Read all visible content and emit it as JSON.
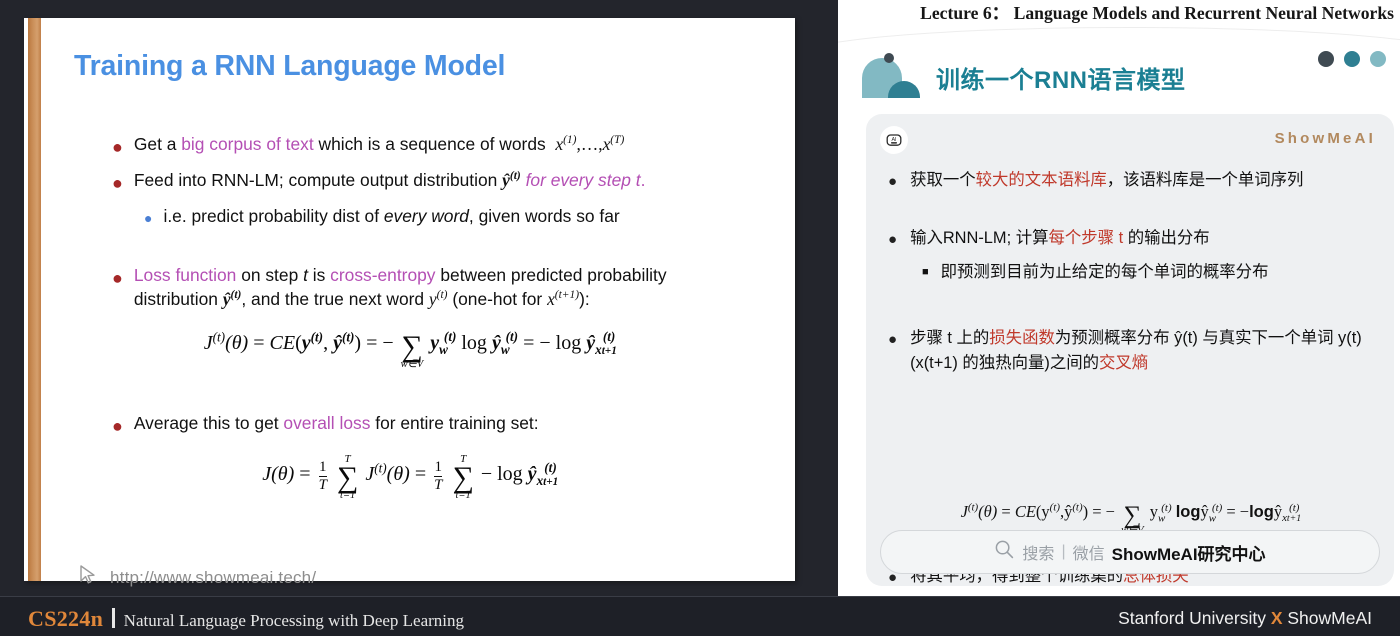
{
  "slide": {
    "title": "Training a RNN Language Model",
    "bullets": [
      {
        "level": 1,
        "pre": "Get a ",
        "highlight": "big corpus of text",
        "post": " which is a sequence of words",
        "math": "x(1), . . . , x(T)"
      },
      {
        "level": 1,
        "pre": "Feed into RNN-LM; compute output distribution ",
        "math_inline": "ŷ(t)",
        "highlight": "for every step t",
        "post": "."
      },
      {
        "level": 2,
        "pre": "i.e. predict probability dist of ",
        "italic": "every word",
        "post": ", given words so far"
      }
    ],
    "loss_bullet": {
      "highlight1": "Loss function",
      "mid1": " on step ",
      "italic_t": "t",
      "mid2": " is ",
      "highlight2": "cross-entropy",
      "mid3": " between predicted probability",
      "line2_pre": "distribution ",
      "line2_math1": "ŷ(t)",
      "line2_mid": ", and the true next word ",
      "line2_math2": "y(t)",
      "line2_post": " (one-hot for ",
      "line2_math3": "x(t+1)",
      "line2_end": "):"
    },
    "equation_1": {
      "lhs": "J(t)(θ) = CE(y(t), ŷ(t)) =",
      "minus": "−",
      "sum_top": "",
      "sum_under": "w∈V",
      "term": "y(t)w log ŷ(t)w",
      "equals": "=",
      "final": "− log ŷ(t)x t+1"
    },
    "avg_bullet": {
      "pre": "Average this to get ",
      "highlight": "overall loss",
      "post": " for entire training set:"
    },
    "equation_2": {
      "lhs": "J(θ) =",
      "frac": "1/T",
      "sum_top": "T",
      "sum_bottom": "t=1",
      "mid": "J(t)(θ) =",
      "final": "− log ŷ(t)x t+1"
    },
    "footer_url": "http://www.showmeai.tech/",
    "footer_icon": "cursor-arrow-icon"
  },
  "right_panel": {
    "lecture_title": "Lecture 6： Language Models and Recurrent Neural Networks",
    "zh_title": "训练一个RNN语言模型",
    "watermark": "ShowMeAI",
    "ai_badge_icon": "ai-robot-icon",
    "deco_dot_colors": [
      "#3f4a52",
      "#2f7f92",
      "#82b9c3"
    ],
    "brand_colors": {
      "light_teal": "#82b9c3",
      "dark_teal": "#2f7f92",
      "slate": "#3f4a52"
    },
    "bullets": [
      {
        "level": 1,
        "parts": [
          {
            "t": "获取一个",
            "c": "normal"
          },
          {
            "t": "较大的文本语料库",
            "c": "red"
          },
          {
            "t": "，该语料库是一个单词序列",
            "c": "normal"
          }
        ]
      },
      {
        "level": 1,
        "parts": [
          {
            "t": "输入RNN-LM; 计算",
            "c": "normal"
          },
          {
            "t": "每个步骤 t",
            "c": "red"
          },
          {
            "t": " 的输出分布",
            "c": "normal"
          }
        ]
      },
      {
        "level": 2,
        "parts": [
          {
            "t": "即预测到目前为止给定的每个单词的概率分布",
            "c": "normal"
          }
        ]
      }
    ],
    "loss_bullet_line1": [
      {
        "t": "步骤 t 上的",
        "c": "normal"
      },
      {
        "t": "损失函数",
        "c": "red"
      },
      {
        "t": "为预测概率分布 ŷ(t) 与真实下一个单",
        "c": "normal"
      }
    ],
    "loss_bullet_line2": [
      {
        "t": "词 y(t) (x(t+1) 的独热向量)之间的",
        "c": "normal"
      },
      {
        "t": "交叉熵",
        "c": "red"
      }
    ],
    "avg_bullet": [
      {
        "t": "将其平均，得到整个训练集的",
        "c": "normal"
      },
      {
        "t": "总体损失",
        "c": "red"
      }
    ],
    "search": {
      "icon": "search-icon",
      "placeholder": "搜索",
      "separator": "|",
      "channel": "微信",
      "brand": "ShowMeAI研究中心"
    }
  },
  "bottom_bar": {
    "course_code": "CS224n",
    "course_name": "Natural Language Processing with Deep Learning",
    "right_pre": "Stanford University ",
    "right_x": "X",
    "right_post": " ShowMeAI",
    "accent_color": "#e0873a"
  }
}
